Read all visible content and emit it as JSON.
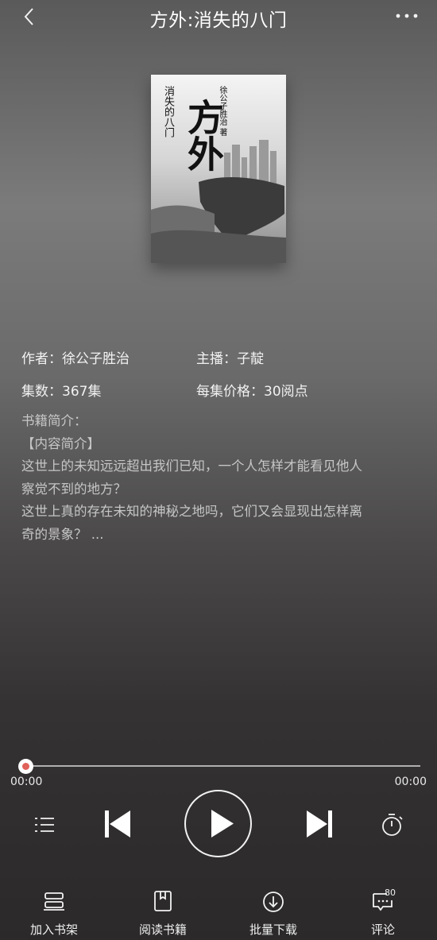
{
  "header": {
    "title": "方外:消失的八门"
  },
  "book": {
    "author_label": "作者：徐公子胜治",
    "narrator_label": "主播：子靛",
    "episodes_label": "集数：367集",
    "price_label": "每集价格：30阅点",
    "cover": {
      "title_big": "方外",
      "subtitle": "消失的八门",
      "author_credit": "徐公子胜治 著"
    }
  },
  "intro": {
    "heading": "书籍简介：",
    "bracket_title": "【内容简介】",
    "line1": "这世上的未知远远超出我们已知，一个人怎样才能看见他人",
    "line2": "察觉不到的地方？",
    "line3": "这世上真的存在未知的神秘之地吗，它们又会显现出怎样离",
    "line4": "奇的景象？ ..."
  },
  "player": {
    "progress_fraction": 0,
    "time_current": "00:00",
    "time_total": "00:00",
    "accent_color": "#e0605a"
  },
  "bottom_tabs": {
    "add_shelf": "加入书架",
    "read_book": "阅读书籍",
    "batch_download": "批量下载",
    "comments": "评论",
    "comments_count": "80"
  }
}
